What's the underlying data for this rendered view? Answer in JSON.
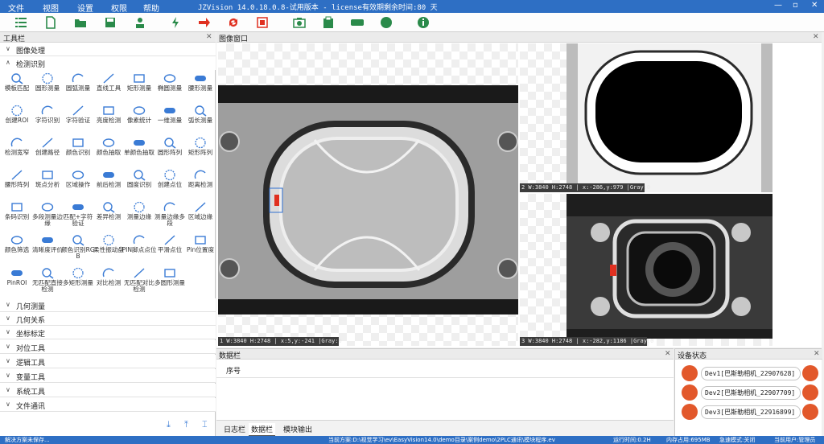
{
  "menu": {
    "file": "文件",
    "view": "视图",
    "settings": "设置",
    "permission": "权限",
    "help": "帮助"
  },
  "window_title": "JZVision 14.0.18.0.8-试用版本 - license有效期剩余时间:80 天",
  "window_buttons": {
    "min": "—",
    "max": "▫",
    "close": "✕"
  },
  "left": {
    "title": "工具栏",
    "close": "✕",
    "categories": {
      "image_proc": "图像处理",
      "detect": "检测识别",
      "geom_measure": "几何测量",
      "geom_relation": "几何关系",
      "coord": "坐标标定",
      "align": "对位工具",
      "logic": "逻辑工具",
      "var": "变量工具",
      "system": "系统工具",
      "comm": "文件通讯"
    },
    "tools": [
      [
        "模板匹配",
        "圆形测量",
        "圆弧测量",
        "直线工具",
        "矩形测量",
        "椭圆测量",
        "腰形测量"
      ],
      [
        "创建ROI",
        "字符识别",
        "字符验证",
        "亮度检测",
        "像素统计",
        "一维测量",
        "弧长测量"
      ],
      [
        "检测宽窄",
        "创建路径",
        "颜色识别",
        "颜色抽取",
        "单颜色抽取",
        "圆形阵列",
        "矩形阵列"
      ],
      [
        "腰形阵列",
        "斑点分析",
        "区域操作",
        "前后检测",
        "圆度识别",
        "创建点位",
        "距离检测"
      ],
      [
        "条码识别",
        "多段测量边缘",
        "匹配+字符验证",
        "差异检测",
        "测量边缘",
        "测量边缘多段",
        "区域边缘"
      ],
      [
        "颜色筛选",
        "清晰度评价",
        "颜色识别RGB",
        "柔性振动盘",
        "PIN脚点点位",
        "平滑点位",
        "Pin位置度"
      ],
      [
        "PinROI",
        "无匹配直接检测",
        "多矩形测量",
        "对比检测",
        "无匹配对比检测",
        "多圆形测量"
      ]
    ]
  },
  "image_window": {
    "title": "图像窗口",
    "close": "✕",
    "views": [
      {
        "status": "1 W:3840 H:2748 | x:5,y:-241 |Gray:0"
      },
      {
        "status": "2 W:3840 H:2748 | x:-286,y:979 |Gray:0"
      },
      {
        "status": "3 W:3840 H:2748 | x:-282,y:1186 |Gray:0"
      }
    ]
  },
  "data_panel": {
    "title": "数据栏",
    "close": "✕",
    "column": "序号",
    "tabs": [
      "日志栏",
      "数据栏",
      "模块输出"
    ]
  },
  "device_panel": {
    "title": "设备状态",
    "close": "✕",
    "devices": [
      "Dev1[巴斯勒相机_22907628]",
      "Dev2[巴斯勒相机_22907709]",
      "Dev3[巴斯勒相机_22916899]"
    ]
  },
  "statusbar": {
    "left": "解决方案未保存...",
    "path": "当前方案:D:\\视觉学习\\ev\\EasyVision14.0\\demo目录\\案例demo\\2PLC通讯\\模块程序.ev",
    "runtime": "运行时间:0.2H",
    "memory": "内存占用:695MB",
    "mode": "急速模式:关闭",
    "user": "当前用户:管理员"
  },
  "colors": {
    "accent": "#2e6fc4",
    "orange": "#e2582b",
    "icon_blue": "#3a7bd5"
  }
}
